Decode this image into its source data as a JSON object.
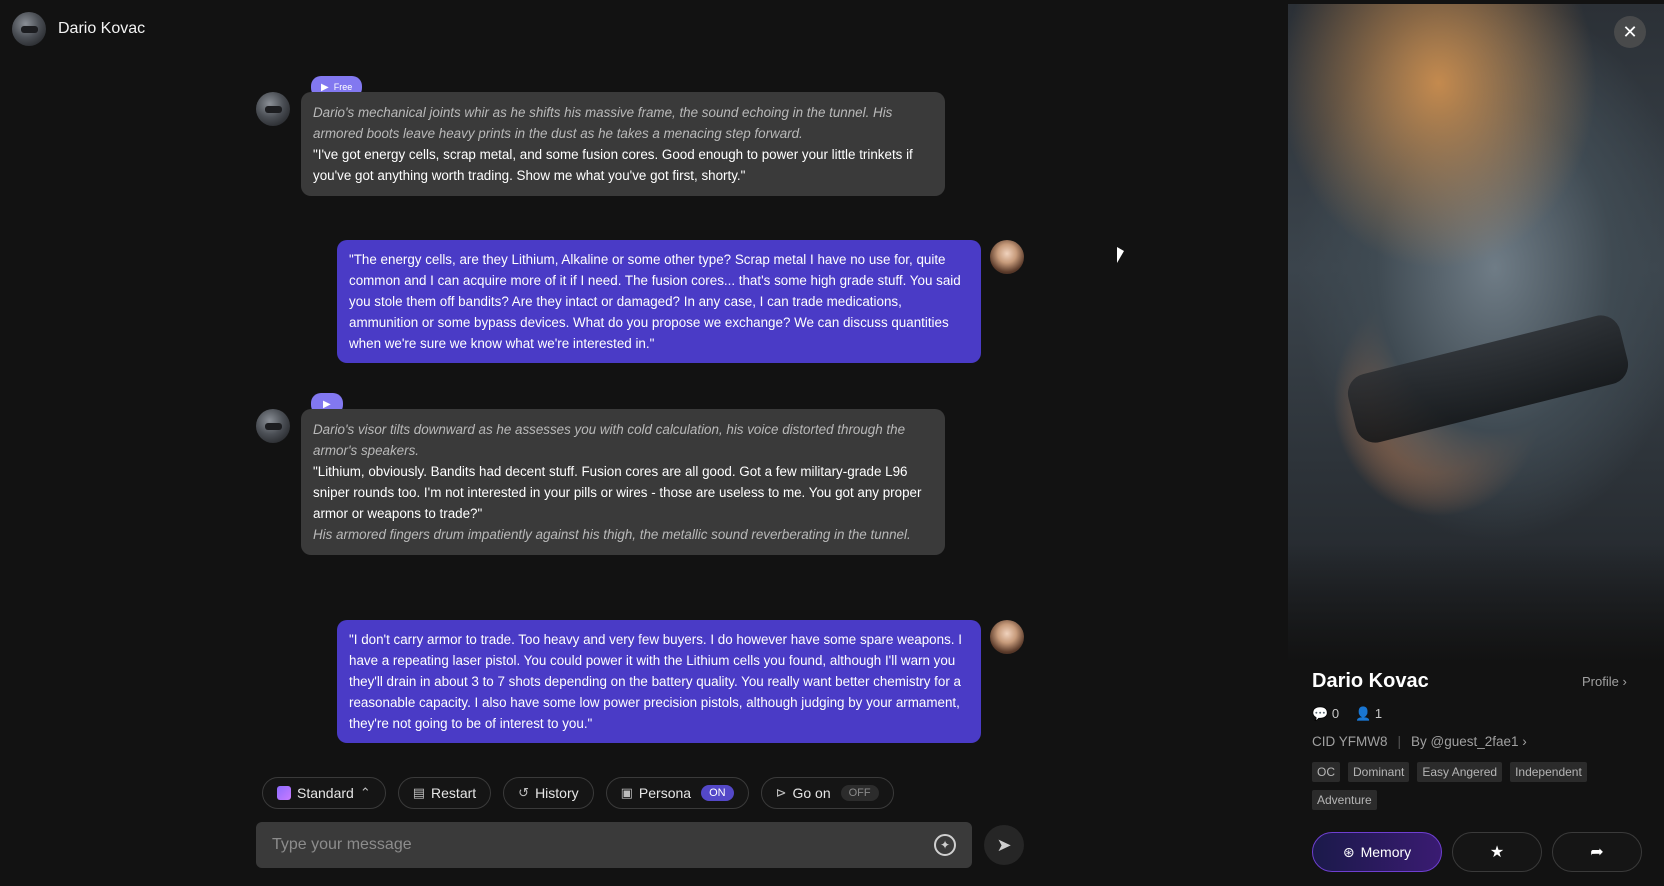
{
  "header": {
    "name": "Dario Kovac"
  },
  "messages": [
    {
      "tag": "Free",
      "narration1": "Dario's mechanical joints whir as he shifts his massive frame, the sound echoing in the tunnel. His armored boots leave heavy prints in the dust as he takes a menacing step forward.",
      "speech": "\"I've got energy cells, scrap metal, and some fusion cores. Good enough to power your little trinkets if you've got anything worth trading. Show me what you've got first, shorty.\""
    },
    {
      "text": "\"The energy cells, are they Lithium, Alkaline or some other type? Scrap metal I have no use for, quite common and I can acquire more of it if I need. The fusion cores... that's some high grade stuff. You said you stole them off bandits? Are they intact or damaged? In any case, I can trade medications, ammunition or some bypass devices. What do you propose we exchange? We can discuss quantities when we're sure we know what we're interested in.\""
    },
    {
      "narration1": "Dario's visor tilts downward as he assesses you with cold calculation, his voice distorted through the armor's speakers.",
      "speech": "\"Lithium, obviously. Bandits had decent stuff. Fusion cores are all good. Got a few military-grade L96 sniper rounds too. I'm not interested in your pills or wires - those are useless to me. You got any proper armor or weapons to trade?\"",
      "narration2": "His armored fingers drum impatiently against his thigh, the metallic sound reverberating in the tunnel."
    },
    {
      "text": "\"I don't carry armor to trade. Too heavy and very few buyers. I do however have some spare weapons. I have a repeating laser pistol. You could power it with the Lithium cells you found, although I'll warn you they'll drain in about 3 to 7 shots depending on the battery quality. You really want better chemistry for a reasonable capacity. I also have some low power precision pistols, although judging by your armament, they're not going to be of interest to you.\""
    }
  ],
  "toolbar": {
    "standard": "Standard",
    "restart": "Restart",
    "history": "History",
    "persona": "Persona",
    "persona_state": "ON",
    "goon": "Go on",
    "goon_state": "OFF"
  },
  "input": {
    "placeholder": "Type your message"
  },
  "profile": {
    "name": "Dario Kovac",
    "profile_link": "Profile ›",
    "chats": "0",
    "followers": "1",
    "cid": "CID YFMW8",
    "by": "By @guest_2fae1 ›",
    "tags": [
      "OC",
      "Dominant",
      "Easy Angered",
      "Independent",
      "Adventure"
    ],
    "memory": "Memory"
  }
}
